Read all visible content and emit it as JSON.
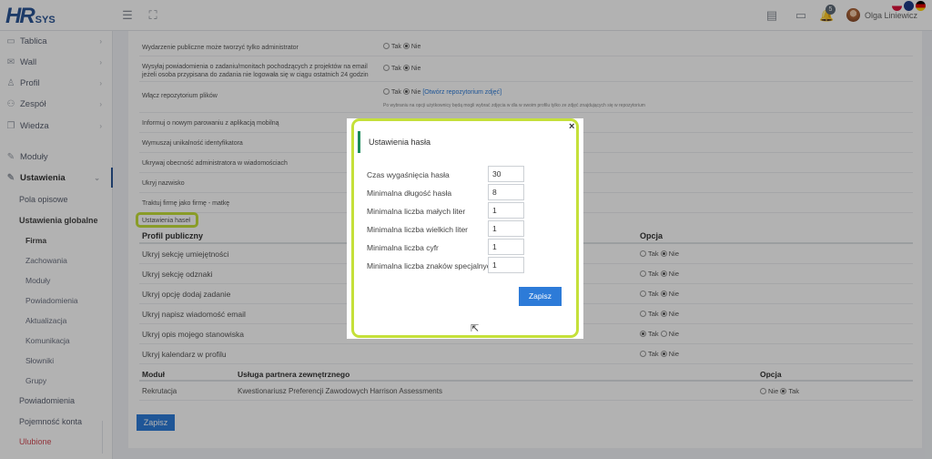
{
  "header": {
    "logo_main": "HR",
    "logo_sub": "SYS",
    "notif_count": "5",
    "username": "Olga Liniewicz"
  },
  "sidebar": {
    "items": [
      {
        "label": "Tablica",
        "icon": "monitor-icon"
      },
      {
        "label": "Wall",
        "icon": "wall-icon"
      },
      {
        "label": "Profil",
        "icon": "user-icon"
      },
      {
        "label": "Zespół",
        "icon": "team-icon"
      },
      {
        "label": "Wiedza",
        "icon": "book-icon"
      },
      {
        "label": "Moduły",
        "icon": "wrench-icon"
      },
      {
        "label": "Ustawienia",
        "icon": "settings-icon"
      }
    ],
    "sub": [
      "Pola opisowe",
      "Ustawienia globalne"
    ],
    "sub2": [
      "Firma",
      "Zachowania",
      "Moduły",
      "Powiadomienia",
      "Aktualizacja",
      "Komunikacja",
      "Słowniki",
      "Grupy"
    ],
    "bottom": [
      "Powiadomienia",
      "Pojemność konta",
      "Ulubione"
    ]
  },
  "settings": {
    "rows": [
      {
        "label": "Wydarzenie publiczne może tworzyć tylko administrator",
        "tak": "Tak",
        "nie": "Nie"
      },
      {
        "label": "Wysyłaj powiadomienia o zadaniu/monitach pochodzących z projektów na email jeżeli osoba przypisana do zadania nie logowała się w ciągu ostatnich 24 godzin",
        "tak": "Tak",
        "nie": "Nie"
      },
      {
        "label": "Włącz repozytorium plików",
        "tak": "Tak",
        "nie": "Nie",
        "link": "[Otwórz repozytorium zdjęć]",
        "note": "Po wybraniu na opcji użytkownicy będą mogli wybrać zdjęcia w dla w swoim profilu tylko ze zdjęć znajdujących się w repozytorium"
      },
      {
        "label": "Informuj o nowym parowaniu z aplikacją mobilną"
      },
      {
        "label": "Wymuszaj unikalność identyfikatora"
      },
      {
        "label": "Ukrywaj obecność administratora w wiadomościach"
      },
      {
        "label": "Ukryj nazwisko"
      },
      {
        "label": "Traktuj firmę jako firmę - matkę"
      },
      {
        "label": "Ustawienia haseł"
      }
    ]
  },
  "profile": {
    "title": "Profil publiczny",
    "option_header": "Opcja",
    "rows": [
      {
        "label": "Ukryj sekcję umiejętności",
        "tak": "Tak",
        "nie": "Nie",
        "selected": "Nie"
      },
      {
        "label": "Ukryj sekcję odznaki",
        "tak": "Tak",
        "nie": "Nie",
        "selected": "Nie"
      },
      {
        "label": "Ukryj opcję dodaj zadanie",
        "tak": "Tak",
        "nie": "Nie",
        "selected": "Nie"
      },
      {
        "label": "Ukryj napisz wiadomość email",
        "tak": "Tak",
        "nie": "Nie",
        "selected": "Nie"
      },
      {
        "label": "Ukryj opis mojego stanowiska",
        "tak": "Tak",
        "nie": "Nie",
        "selected": "Tak"
      },
      {
        "label": "Ukryj kalendarz w profilu",
        "tak": "Tak",
        "nie": "Nie",
        "selected": "Nie"
      }
    ]
  },
  "modules": {
    "col1": "Moduł",
    "col2": "Usługa partnera zewnętrznego",
    "col3": "Opcja",
    "row": {
      "module": "Rekrutacja",
      "service": "Kwestionariusz Preferencji Zawodowych Harrison Assessments",
      "nie": "Nie",
      "tak": "Tak"
    }
  },
  "save_label": "Zapisz",
  "modal": {
    "title": "Ustawienia hasła",
    "close": "×",
    "fields": [
      {
        "label": "Czas wygaśnięcia hasła",
        "value": "30"
      },
      {
        "label": "Minimalna długość hasła",
        "value": "8"
      },
      {
        "label": "Minimalna liczba małych liter",
        "value": "1"
      },
      {
        "label": "Minimalna liczba wielkich liter",
        "value": "1"
      },
      {
        "label": "Minimalna liczba cyfr",
        "value": "1"
      },
      {
        "label": "Minimalna liczba znaków specjalnych",
        "value": "1"
      }
    ],
    "save_label": "Zapisz"
  },
  "colors": {
    "accent": "#2d7bd8",
    "highlight": "#c5e03a",
    "title_bar": "#1a8a5a"
  }
}
